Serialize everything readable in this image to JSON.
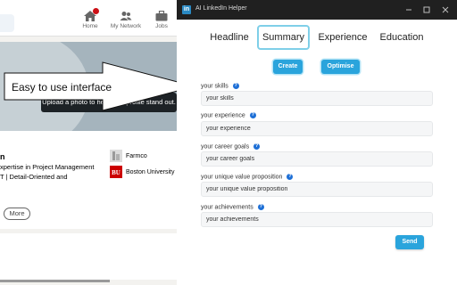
{
  "background_page": {
    "nav": [
      {
        "label": "Home",
        "icon": "home-icon",
        "has_badge": true
      },
      {
        "label": "My Network",
        "icon": "people-icon",
        "has_badge": false
      },
      {
        "label": "Jobs",
        "icon": "briefcase-icon",
        "has_badge": false
      }
    ],
    "profile": {
      "photo_tooltip": "Upload a photo to help your profile stand out.",
      "name_fragment": "n",
      "headline_line1": "xpertise in Project Management",
      "headline_line2": "T | Detail-Oriented and",
      "more_button": "More"
    },
    "organizations": [
      {
        "name": "Farmco",
        "logo": "farmco-logo"
      },
      {
        "name": "Boston University",
        "logo": "boston-university-logo"
      }
    ]
  },
  "annotation": {
    "callout_text": "Easy to use interface"
  },
  "app": {
    "title": "AI LinkedIn Helper",
    "icon_letter": "in",
    "window_controls": [
      "minimize-icon",
      "maximize-icon",
      "close-icon"
    ],
    "tabs": [
      {
        "label": "Headline",
        "active": false
      },
      {
        "label": "Summary",
        "active": true
      },
      {
        "label": "Experience",
        "active": false
      },
      {
        "label": "Education",
        "active": false
      }
    ],
    "actions": {
      "create_label": "Create",
      "optimise_label": "Optimise"
    },
    "fields": [
      {
        "label": "your skills",
        "placeholder": "your skills"
      },
      {
        "label": "your experience",
        "placeholder": "your experience"
      },
      {
        "label": "your career goals",
        "placeholder": "your career goals"
      },
      {
        "label": "your unique value proposition",
        "placeholder": "your unique value proposition"
      },
      {
        "label": "your achievements",
        "placeholder": "your achievements"
      }
    ],
    "help_glyph": "?",
    "send_label": "Send"
  },
  "colors": {
    "accent": "#2aa4dc",
    "tab_outline": "#7fcfe8",
    "titlebar": "#202020",
    "help_icon": "#1d6fd6",
    "notification": "#cc1016"
  }
}
